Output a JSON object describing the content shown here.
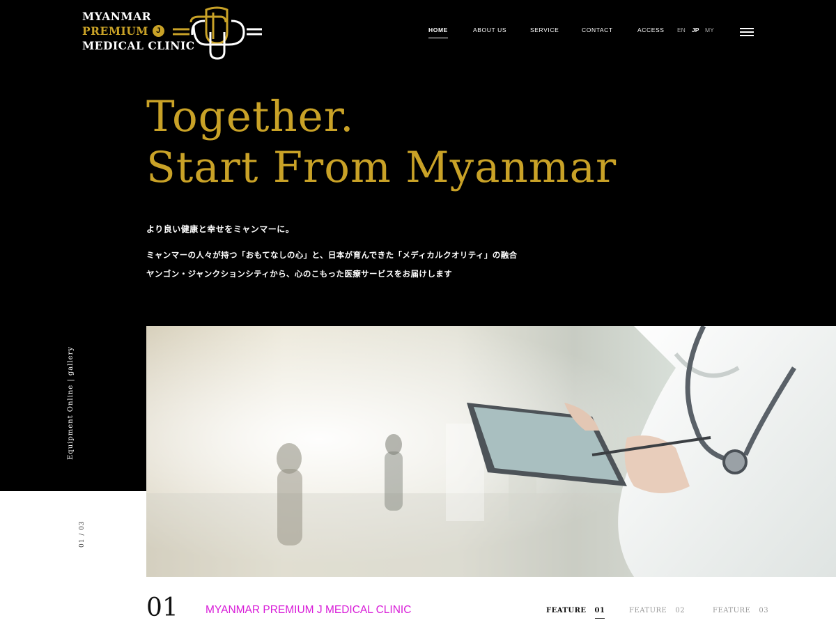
{
  "logo": {
    "line1": "MYANMAR",
    "line2": "PREMIUM",
    "j_badge": "J",
    "line3": "MEDICAL CLINIC"
  },
  "nav": {
    "items": [
      "HOME",
      "ABOUT US",
      "SERVICE",
      "CONTACT",
      "ACCESS"
    ],
    "active": "HOME",
    "languages": [
      "EN",
      "JP",
      "MY"
    ],
    "active_language": "JP"
  },
  "hero": {
    "headline_line1": "Together.",
    "headline_line2": "Start From Myanmar",
    "tagline": "より良い健康と幸せをミャンマーに。",
    "desc_line1": "ミャンマーの人々が持つ「おもてなしの心」と、日本が育んできた「メディカルクオリティ」の融合",
    "desc_line2": "ヤンゴン・ジャンクションシティから、心のこもった医療サービスをお届けします"
  },
  "side": {
    "vertical_label": "Equipment Online | gallery",
    "slide_counter": "01 / 03"
  },
  "section": {
    "number": "01",
    "title": "MYANMAR PREMIUM J MEDICAL CLINIC"
  },
  "features": [
    {
      "label": "FEATURE",
      "num": "01"
    },
    {
      "label": "FEATURE",
      "num": "02"
    },
    {
      "label": "FEATURE",
      "num": "03"
    }
  ],
  "colors": {
    "gold": "#c9a227",
    "magenta": "#d81bd8",
    "background": "#000000"
  }
}
